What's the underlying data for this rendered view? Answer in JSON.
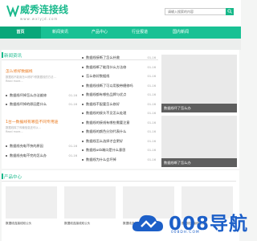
{
  "header": {
    "logo_text": "威秀连接线",
    "logo_sub": "www.wxlyjd.com",
    "search_placeholder": "请输入搜索的内容"
  },
  "nav": {
    "items": [
      "首页",
      "新闻资讯",
      "产品中心",
      "行业报道",
      "国内新闻"
    ]
  },
  "news": {
    "title": "新闻资讯",
    "feature1": {
      "title": "怎么修好数据线",
      "desc_line1": "数据线不能用怎么修好?修数据线的方法...",
      "desc_line2": "Read more..."
    },
    "feature2": {
      "title": "1台一数据线有哪些不同专用途",
      "desc_line1": "数据线除了传输信息还可以...",
      "desc_line2": "Read more..."
    },
    "left_list": [
      {
        "text": "数据线坏掉怎么办法维修",
        "date": "01-16"
      },
      {
        "text": "数据线坏掉的原因是什么",
        "date": "01-16"
      },
      {
        "text": "数据线充电不快的原因",
        "date": "01-16"
      },
      {
        "text": "数据线充电不完的怎么办",
        "date": "01-16"
      }
    ],
    "mid_list": [
      {
        "text": "数据线接断了怎么补救",
        "date": "01-16"
      },
      {
        "text": "数据线断了能用什么方法修",
        "date": "01-16"
      },
      {
        "text": "怎么修好数据线",
        "date": "01-16"
      },
      {
        "text": "数据线线断了可以用胶带缠修吗",
        "date": "01-16"
      },
      {
        "text": "数据线都有哪些品牌与优点",
        "date": "01-16"
      },
      {
        "text": "数据线不配要怎么修好",
        "date": "01-16"
      },
      {
        "text": "数据线的接头不见怎么处理",
        "date": "01-16"
      },
      {
        "text": "数据线的接线有哪些需要注意",
        "date": "01-16"
      },
      {
        "text": "数据线的颜色分别代表什么",
        "date": "01-16"
      },
      {
        "text": "数据线怎么选择才会更好",
        "date": "01-16"
      },
      {
        "text": "数据线usb端口是什么意思",
        "date": "01-16"
      },
      {
        "text": "数据线为什么会坏掉",
        "date": "01-16"
      }
    ],
    "thumb1_caption": "数据线坏了怎么办",
    "thumb2_caption": "数据线断了怎么办"
  },
  "products": {
    "title": "产品中心",
    "items": [
      "数据线连接线双公头",
      "数据线连接线双公头",
      "数据线连接线双公头",
      "数据线连接线双公头"
    ]
  },
  "watermark": {
    "text": "008导航",
    "sub": "008DH.COM"
  },
  "colors": {
    "brand_green": "#19c194",
    "accent_orange": "#ea7a1f",
    "watermark_blue": "#1c5fc8"
  }
}
